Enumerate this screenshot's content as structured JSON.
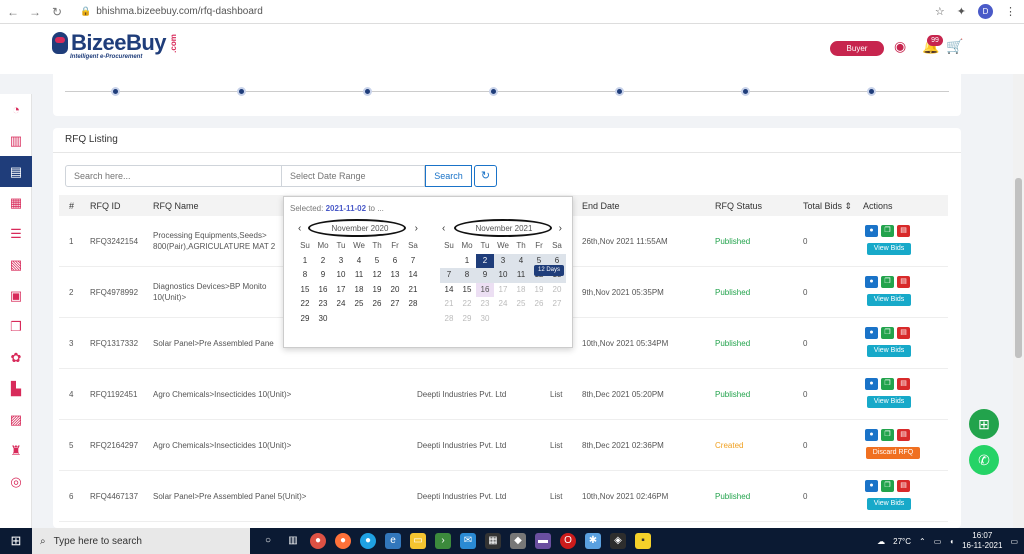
{
  "browser": {
    "url": "bhishma.bizeebuy.com/rfq-dashboard",
    "profile_initial": "D"
  },
  "header": {
    "logo": "BizeeBuy",
    "logo_com": ".com",
    "tagline": "Intelligent e-Procurement",
    "role_button": "Buyer",
    "notification_count": "99"
  },
  "sidebar": {
    "icons": [
      "dashboard-icon",
      "chart-icon",
      "rfq-icon",
      "document-icon",
      "list-icon",
      "report-icon",
      "briefcase-icon",
      "copy-icon",
      "bulb-icon",
      "factory-icon",
      "file-icon",
      "lamp-icon",
      "eye-icon"
    ],
    "active_index": 2
  },
  "rfq": {
    "title": "RFQ Listing",
    "search_placeholder": "Search here...",
    "date_placeholder": "Select Date Range",
    "search_button": "Search",
    "headers": {
      "num": "#",
      "id": "RFQ ID",
      "name": "RFQ Name",
      "end": "End Date",
      "status": "RFQ Status",
      "bids": "Total Bids ⇕",
      "actions": "Actions"
    },
    "rows": [
      {
        "num": "1",
        "id": "RFQ3242154",
        "name1": "Processing Equipments,Seeds>",
        "name2": "800(Pair),AGRICULATURE MAT 2",
        "company": "",
        "type": "",
        "end": "26th,Nov 2021 11:55AM",
        "status": "Published",
        "bids": "0",
        "action_btn": "View Bids"
      },
      {
        "num": "2",
        "id": "RFQ4978992",
        "name1": "Diagnostics Devices>BP Monito",
        "name2": "10(Unit)>",
        "company": "",
        "type": "",
        "end": "9th,Nov 2021 05:35PM",
        "status": "Published",
        "bids": "0",
        "action_btn": "View Bids"
      },
      {
        "num": "3",
        "id": "RFQ1317332",
        "name1": "Solar Panel>Pre Assembled Pane",
        "name2": "",
        "company": "",
        "type": "",
        "end": "10th,Nov 2021 05:34PM",
        "status": "Published",
        "bids": "0",
        "action_btn": "View Bids"
      },
      {
        "num": "4",
        "id": "RFQ1192451",
        "name1": "Agro Chemicals>Insecticides 10(Unit)>",
        "name2": "",
        "company": "Deepti Industries Pvt. Ltd",
        "type": "List",
        "end": "8th,Dec 2021 05:20PM",
        "status": "Published",
        "bids": "0",
        "action_btn": "View Bids"
      },
      {
        "num": "5",
        "id": "RFQ2164297",
        "name1": "Agro Chemicals>Insecticides 10(Unit)>",
        "name2": "",
        "company": "Deepti Industries Pvt. Ltd",
        "type": "List",
        "end": "8th,Dec 2021 02:36PM",
        "status": "Created",
        "bids": "0",
        "action_btn": "Discard RFQ"
      },
      {
        "num": "6",
        "id": "RFQ4467137",
        "name1": "Solar Panel>Pre Assembled Panel 5(Unit)>",
        "name2": "",
        "company": "Deepti Industries Pvt. Ltd",
        "type": "List",
        "end": "10th,Nov 2021 02:46PM",
        "status": "Published",
        "bids": "0",
        "action_btn": "View Bids"
      }
    ]
  },
  "datepicker": {
    "selected_label": "Selected:",
    "selected_value": "2021-11-02",
    "selected_suffix": "to ...",
    "tooltip": "12 Days",
    "weekdays": [
      "Su",
      "Mo",
      "Tu",
      "We",
      "Th",
      "Fr",
      "Sa"
    ],
    "left": {
      "month": "November 2020",
      "days": [
        "1",
        "2",
        "3",
        "4",
        "5",
        "6",
        "7",
        "8",
        "9",
        "10",
        "11",
        "12",
        "13",
        "14",
        "15",
        "16",
        "17",
        "18",
        "19",
        "20",
        "21",
        "22",
        "23",
        "24",
        "25",
        "26",
        "27",
        "28",
        "29",
        "30"
      ],
      "lead": 0
    },
    "right": {
      "month": "November 2021",
      "days": [
        "1",
        "2",
        "3",
        "4",
        "5",
        "6",
        "7",
        "8",
        "9",
        "10",
        "11",
        "12",
        "13",
        "14",
        "15",
        "16",
        "17",
        "18",
        "19",
        "20",
        "21",
        "22",
        "23",
        "24",
        "25",
        "26",
        "27",
        "28",
        "29",
        "30"
      ],
      "lead": 1
    }
  },
  "taskbar": {
    "search": "Type here to search",
    "weather": "27°C",
    "time": "16:07",
    "date": "16-11-2021"
  }
}
